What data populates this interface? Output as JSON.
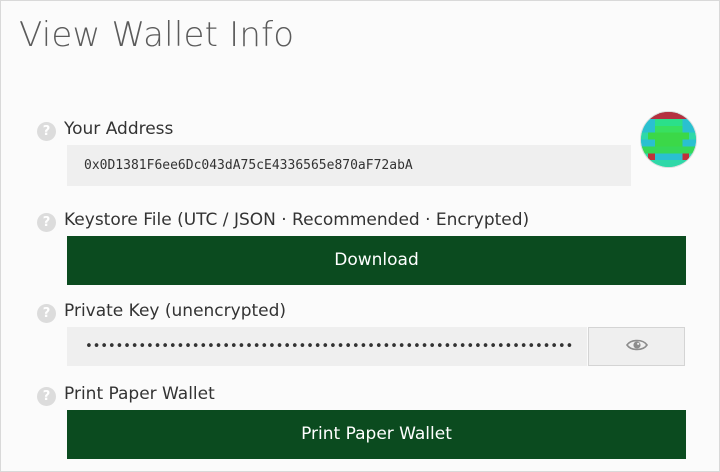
{
  "page": {
    "title": "View Wallet Info"
  },
  "address": {
    "help_icon": "?",
    "label": "Your Address",
    "value": "0x0D1381F6ee6Dc043dA75cE4336565e870aF72abA",
    "identicon": "identicon-icon"
  },
  "keystore": {
    "help_icon": "?",
    "label": "Keystore File (UTC / JSON · Recommended · Encrypted)",
    "button_label": "Download"
  },
  "private_key": {
    "help_icon": "?",
    "label": "Private Key (unencrypted)",
    "masked_value": "••••••••••••••••••••••••••••••••••••••••••••••••••••••••••••••••",
    "toggle_icon": "eye-icon"
  },
  "paper_wallet": {
    "help_icon": "?",
    "label": "Print Paper Wallet",
    "button_label": "Print Paper Wallet"
  },
  "colors": {
    "button_bg": "#0b4b1f",
    "field_bg": "#efefef",
    "title_text": "#5b5b5b"
  }
}
